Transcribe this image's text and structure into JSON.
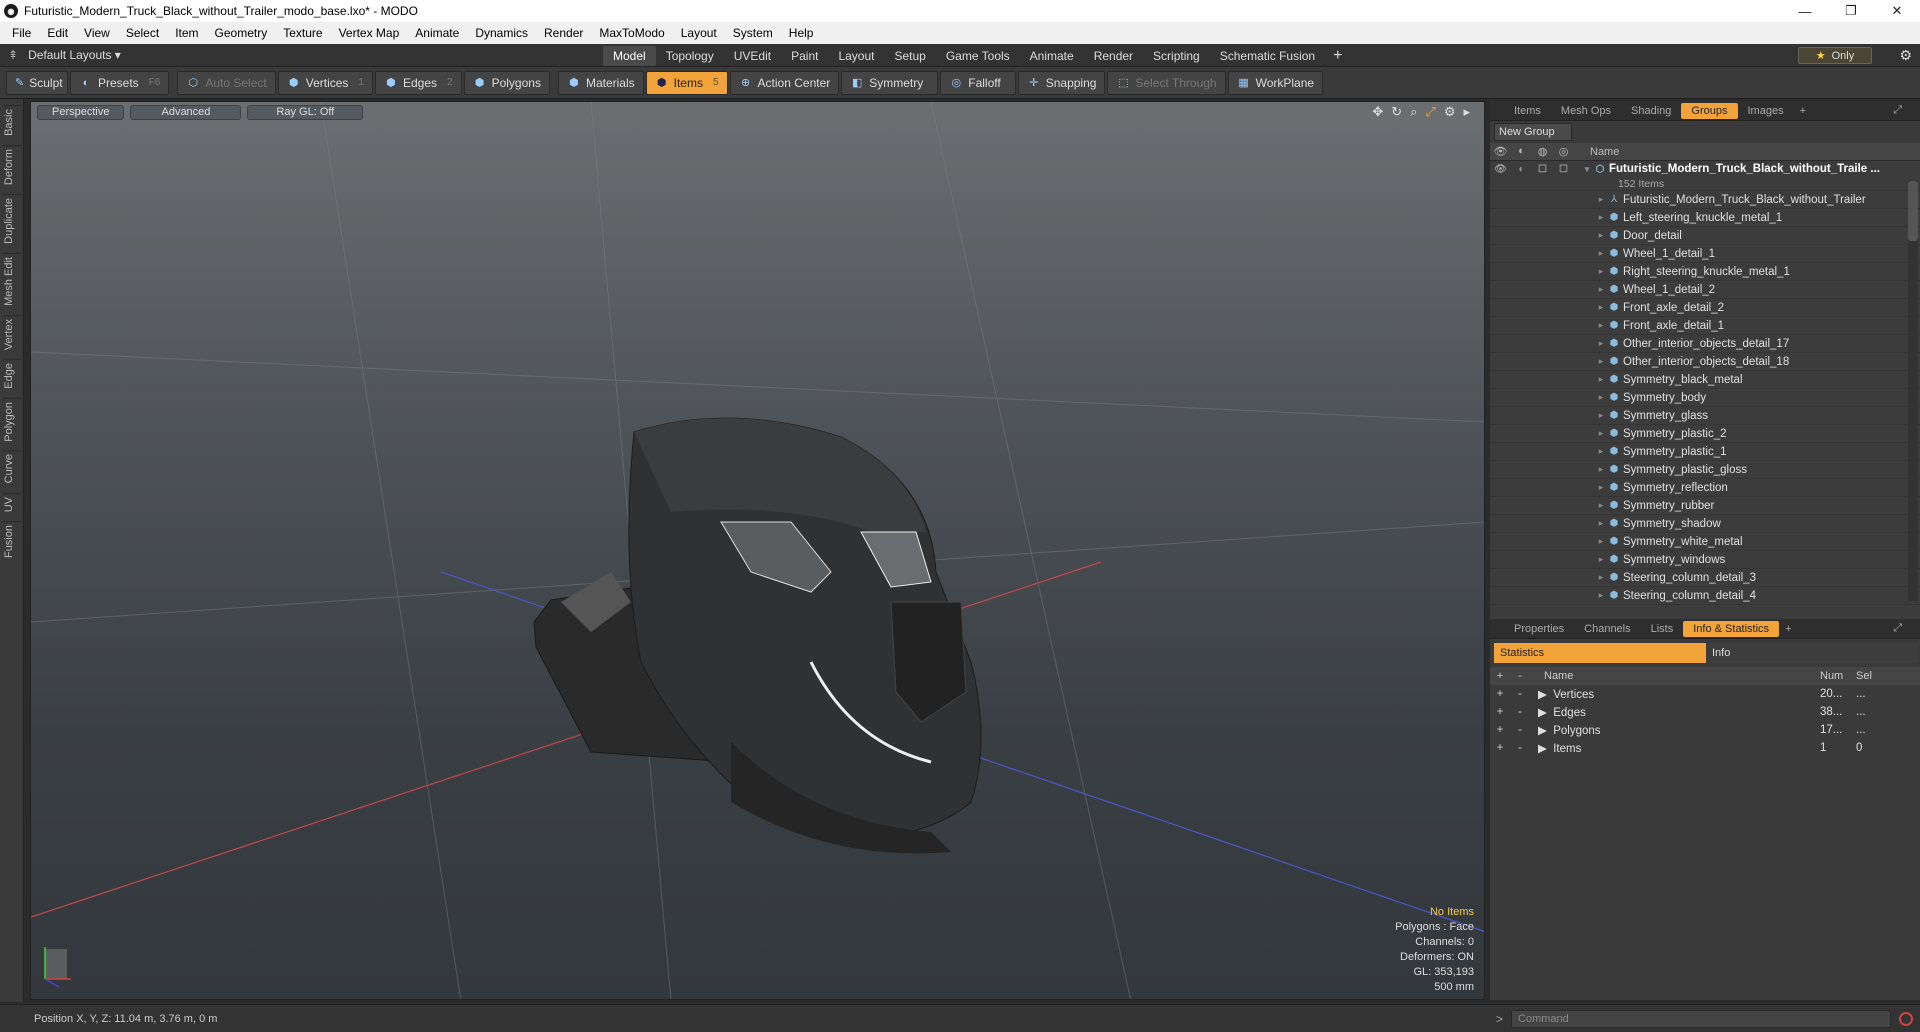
{
  "window": {
    "title": "Futuristic_Modern_Truck_Black_without_Trailer_modo_base.lxo* - MODO",
    "app_icon": "modo-icon"
  },
  "menu": [
    "File",
    "Edit",
    "View",
    "Select",
    "Item",
    "Geometry",
    "Texture",
    "Vertex Map",
    "Animate",
    "Dynamics",
    "Render",
    "MaxToModo",
    "Layout",
    "System",
    "Help"
  ],
  "layout": {
    "dropdown": "Default Layouts",
    "tabs": [
      "Model",
      "Topology",
      "UVEdit",
      "Paint",
      "Layout",
      "Setup",
      "Game Tools",
      "Animate",
      "Render",
      "Scripting",
      "Schematic Fusion"
    ],
    "active_tab": "Model",
    "only_label": "Only",
    "only_star": "★"
  },
  "toolbar": {
    "sculpt": "Sculpt",
    "presets": "Presets",
    "presets_key": "F6",
    "auto_select": "Auto Select",
    "vertices": "Vertices",
    "vertices_key": "1",
    "edges": "Edges",
    "edges_key": "2",
    "polygons": "Polygons",
    "materials": "Materials",
    "items": "Items",
    "items_key": "5",
    "action_center": "Action Center",
    "symmetry": "Symmetry",
    "falloff": "Falloff",
    "snapping": "Snapping",
    "select_through": "Select Through",
    "workplane": "WorkPlane"
  },
  "left_tabs": [
    "Basic",
    "Deform",
    "Duplicate",
    "Mesh Edit",
    "Vertex",
    "Edge",
    "Polygon",
    "Curve",
    "UV",
    "Fusion"
  ],
  "viewport": {
    "view": "Perspective",
    "shading": "Advanced",
    "raygl": "Ray GL: Off",
    "info": {
      "selection": "No Items",
      "polygons": "Polygons : Face",
      "channels": "Channels: 0",
      "deformers": "Deformers: ON",
      "gl": "GL: 353,193",
      "scale": "500 mm"
    }
  },
  "groups_panel": {
    "tabs": [
      "Items",
      "Mesh Ops",
      "Shading",
      "Groups",
      "Images"
    ],
    "active_tab": "Groups",
    "new_group": "New Group",
    "name_header": "Name",
    "root": "Futuristic_Modern_Truck_Black_without_Traile ...",
    "root_count": "152 Items",
    "items": [
      "Futuristic_Modern_Truck_Black_without_Trailer",
      "Left_steering_knuckle_metal_1",
      "Door_detail",
      "Wheel_1_detail_1",
      "Right_steering_knuckle_metal_1",
      "Wheel_1_detail_2",
      "Front_axle_detail_2",
      "Front_axle_detail_1",
      "Other_interior_objects_detail_17",
      "Other_interior_objects_detail_18",
      "Symmetry_black_metal",
      "Symmetry_body",
      "Symmetry_glass",
      "Symmetry_plastic_2",
      "Symmetry_plastic_1",
      "Symmetry_plastic_gloss",
      "Symmetry_reflection",
      "Symmetry_rubber",
      "Symmetry_shadow",
      "Symmetry_white_metal",
      "Symmetry_windows",
      "Steering_column_detail_3",
      "Steering_column_detail_4"
    ]
  },
  "stats_panel": {
    "tabs": [
      "Properties",
      "Channels",
      "Lists",
      "Info & Statistics"
    ],
    "active_tab": "Info & Statistics",
    "subtab_statistics": "Statistics",
    "subtab_info": "Info",
    "headers": {
      "name": "Name",
      "num": "Num",
      "sel": "Sel"
    },
    "rows": [
      {
        "name": "Vertices",
        "num": "20...",
        "sel": "..."
      },
      {
        "name": "Edges",
        "num": "38...",
        "sel": "..."
      },
      {
        "name": "Polygons",
        "num": "17...",
        "sel": "..."
      },
      {
        "name": "Items",
        "num": "1",
        "sel": "0"
      }
    ]
  },
  "status": {
    "position": "Position X, Y, Z:   11.04 m, 3.76 m, 0 m"
  },
  "command": {
    "placeholder": "Command"
  },
  "colors": {
    "accent": "#f2a33a",
    "warn": "#f2c94a"
  }
}
